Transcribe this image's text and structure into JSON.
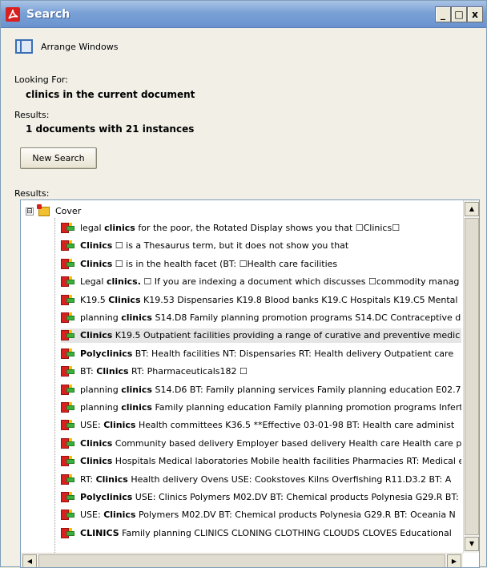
{
  "window": {
    "title": "Search",
    "controls": {
      "minimize": "_",
      "maximize": "□",
      "close": "x"
    }
  },
  "arrange": {
    "label": "Arrange Windows",
    "icon": "arrange-windows-icon"
  },
  "looking_for": {
    "label": "Looking For:",
    "value": "clinics in the current document"
  },
  "summary": {
    "label": "Results:",
    "value": "1 documents with 21 instances"
  },
  "new_search": {
    "label": "New Search"
  },
  "results": {
    "label": "Results:",
    "root": {
      "label": "Cover",
      "icon": "pdf-folder-icon",
      "expander": "⊟"
    },
    "items": [
      {
        "pre": "legal ",
        "term": "clinics",
        "post": " for the poor, the Rotated Display shows you that ☐Clinics☐"
      },
      {
        "pre": "",
        "term": "Clinics",
        "post": " ☐ is a Thesaurus term, but it does not show you that"
      },
      {
        "pre": "",
        "term": "Clinics",
        "post": " ☐ is in the health facet (BT: ☐Health care facilities"
      },
      {
        "pre": "Legal ",
        "term": "clinics.",
        "post": " ☐ If you are indexing a document which discusses ☐commodity manag"
      },
      {
        "pre": "K19.5 ",
        "term": "Clinics",
        "post": " K19.53 Dispensaries K19.8 Blood banks K19.C Hospitals K19.C5 Mental"
      },
      {
        "pre": "planning ",
        "term": "clinics",
        "post": " S14.D8 Family planning promotion programs S14.DC Contraceptive d"
      },
      {
        "pre": "",
        "term": "Clinics",
        "post": " K19.5 Outpatient facilities providing a range of curative and preventive medic"
      },
      {
        "pre": "",
        "term": "Polyclinics",
        "post": " BT: Health facilities NT: Dispensaries RT: Health delivery Outpatient care"
      },
      {
        "pre": "BT: ",
        "term": "Clinics",
        "post": " RT: Pharmaceuticals182 ☐"
      },
      {
        "pre": "planning ",
        "term": "clinics",
        "post": " S14.D6 BT: Family planning services Family planning education E02.7"
      },
      {
        "pre": "planning ",
        "term": "clinics",
        "post": " Family planning education Family planning promotion programs Infert"
      },
      {
        "pre": "USE: ",
        "term": "Clinics",
        "post": " Health committees K36.5 **Effective 03-01-98 BT: Health care administ"
      },
      {
        "pre": "",
        "term": "Clinics",
        "post": " Community based delivery Employer based delivery Health care Health care p"
      },
      {
        "pre": "",
        "term": "Clinics",
        "post": " Hospitals Medical laboratories Mobile health facilities Pharmacies RT: Medical e"
      },
      {
        "pre": "RT: ",
        "term": "Clinics",
        "post": " Health delivery Ovens USE: Cookstoves Kilns Overfishing R11.D3.2 BT: A"
      },
      {
        "pre": "",
        "term": "Polyclinics",
        "post": " USE: Clinics Polymers M02.DV BT: Chemical products Polynesia G29.R BT:"
      },
      {
        "pre": "USE: ",
        "term": "Clinics",
        "post": " Polymers M02.DV BT: Chemical products Polynesia G29.R BT: Oceania N"
      },
      {
        "pre": "",
        "term": "CLINICS",
        "post": " Family planning CLINICS CLONING CLOTHING CLOUDS CLOVES Educational"
      }
    ],
    "selected_index": 6
  },
  "colors": {
    "title_bar": "#7aa1d6",
    "pdf_red": "#d9201e",
    "arrow_green": "#3cae3c",
    "window_bg": "#f1efe6"
  }
}
